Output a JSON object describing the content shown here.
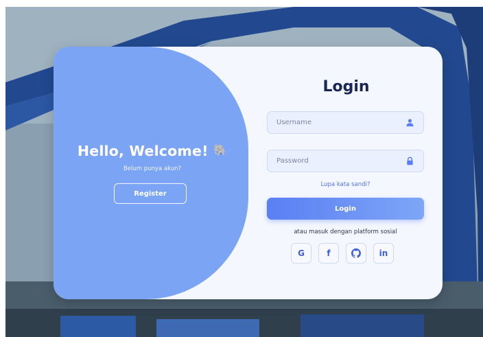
{
  "left_panel": {
    "welcome_title": "Hello, Welcome!",
    "welcome_emoji": "🐘",
    "no_account_text": "Belum punya akun?",
    "register_label": "Register"
  },
  "login_form": {
    "title": "Login",
    "username": {
      "placeholder": "Username",
      "value": "",
      "icon": "user-icon"
    },
    "password": {
      "placeholder": "Password",
      "value": "",
      "icon": "lock-icon"
    },
    "forgot_password_label": "Lupa kata sandi?",
    "login_button_label": "Login",
    "social_text": "atau masuk dengan platform sosial",
    "social_buttons": [
      {
        "label": "G",
        "icon": "google-icon"
      },
      {
        "label": "f",
        "icon": "facebook-icon"
      },
      {
        "label": "",
        "icon": "github-icon"
      },
      {
        "label": "in",
        "icon": "linkedin-icon"
      }
    ]
  },
  "colors": {
    "panel_blue": "#7ba4f5",
    "accent": "#5a7ff3",
    "title_navy": "#1b2556",
    "card_bg": "#f4f7fe"
  }
}
